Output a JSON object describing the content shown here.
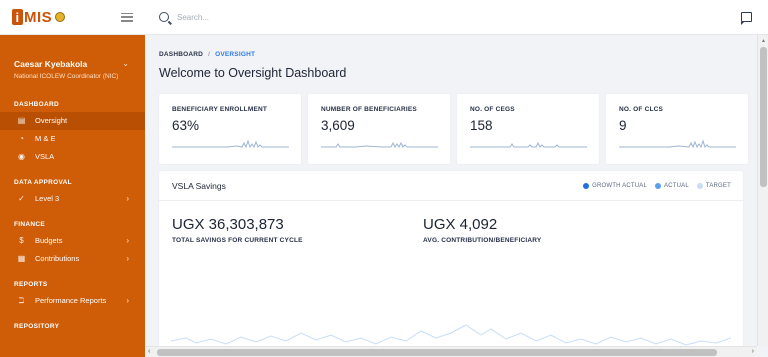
{
  "app": {
    "logo_text": "iMIS",
    "logo_first": "i",
    "logo_rest": "MIS"
  },
  "user": {
    "name": "Caesar Kyebakola",
    "role": "National ICOLEW Coordinator (NIC)"
  },
  "sidebar": {
    "sections": [
      {
        "title": "DASHBOARD",
        "items": [
          {
            "label": "Oversight",
            "icon": "calendar-icon",
            "active": true
          },
          {
            "label": "M & E",
            "icon": "pie-chart-icon"
          },
          {
            "label": "VSLA",
            "icon": "coins-icon"
          }
        ]
      },
      {
        "title": "DATA APPROVAL",
        "items": [
          {
            "label": "Level 3",
            "icon": "check-icon"
          }
        ]
      },
      {
        "title": "FINANCE",
        "items": [
          {
            "label": "Budgets",
            "icon": "dollar-icon"
          },
          {
            "label": "Contributions",
            "icon": "grid-icon"
          }
        ]
      },
      {
        "title": "REPORTS",
        "items": [
          {
            "label": "Performance Reports",
            "icon": "bar-chart-icon"
          }
        ]
      },
      {
        "title": "REPOSITORY",
        "items": []
      }
    ]
  },
  "search": {
    "placeholder": "Search..."
  },
  "breadcrumb": {
    "root": "DASHBOARD",
    "separator": "/",
    "current": "OVERSIGHT"
  },
  "page": {
    "title": "Welcome to Oversight Dashboard"
  },
  "cards": [
    {
      "label": "BENEFICIARY ENROLLMENT",
      "value": "63%"
    },
    {
      "label": "NUMBER OF BENEFICIARIES",
      "value": "3,609"
    },
    {
      "label": "NO. OF CEGS",
      "value": "158"
    },
    {
      "label": "NO. OF CLCS",
      "value": "9"
    }
  ],
  "savings": {
    "title": "VSLA Savings",
    "legend": [
      {
        "label": "GROWTH ACTUAL",
        "color": "#1f6fe0"
      },
      {
        "label": "ACTUAL",
        "color": "#5a9ef0"
      },
      {
        "label": "TARGET",
        "color": "#c8ddf8"
      }
    ],
    "total_savings": {
      "value": "UGX 36,303,873",
      "label": "TOTAL SAVINGS FOR CURRENT CYCLE"
    },
    "avg_contribution": {
      "value": "UGX 4,092",
      "label": "AVG. CONTRIBUTION/BENEFICIARY"
    }
  },
  "colors": {
    "sidebar": "#cf5c06",
    "accent": "#2d7be5",
    "spark": "#9db4d3"
  }
}
